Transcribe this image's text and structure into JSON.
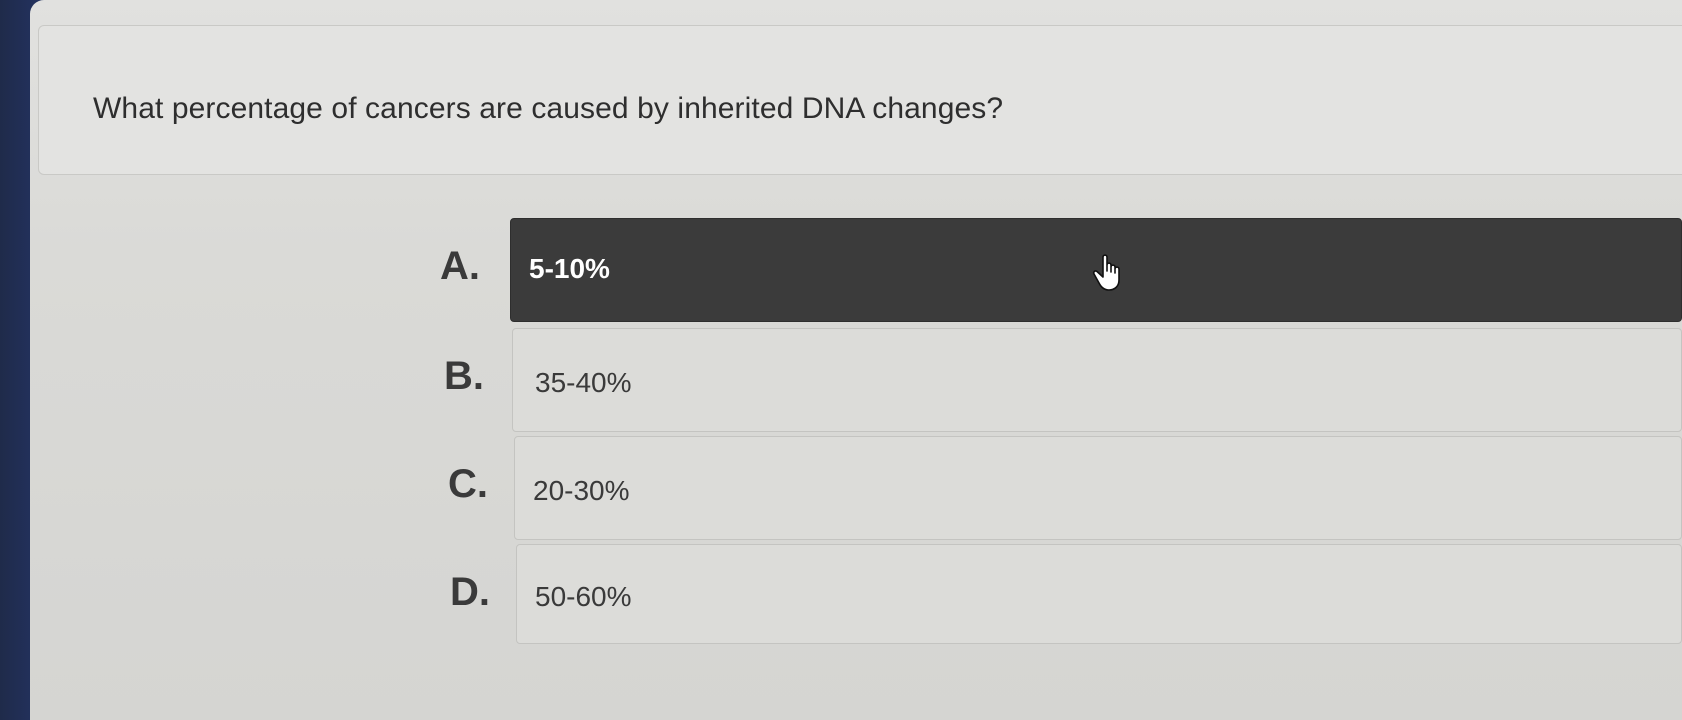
{
  "question": {
    "text": "What percentage of cancers are caused by inherited DNA changes?"
  },
  "options": [
    {
      "letter": "A.",
      "text": "5-10%",
      "selected": true
    },
    {
      "letter": "B.",
      "text": "35-40%",
      "selected": false
    },
    {
      "letter": "C.",
      "text": "20-30%",
      "selected": false
    },
    {
      "letter": "D.",
      "text": "50-60%",
      "selected": false
    }
  ],
  "colors": {
    "selected_bg": "#3b3b3b",
    "option_bg": "#dcdcd9",
    "page_bg": "#d8d8d5",
    "frame_edge": "#1f2b4a"
  },
  "icons": {
    "cursor": "hand-pointer-icon"
  }
}
